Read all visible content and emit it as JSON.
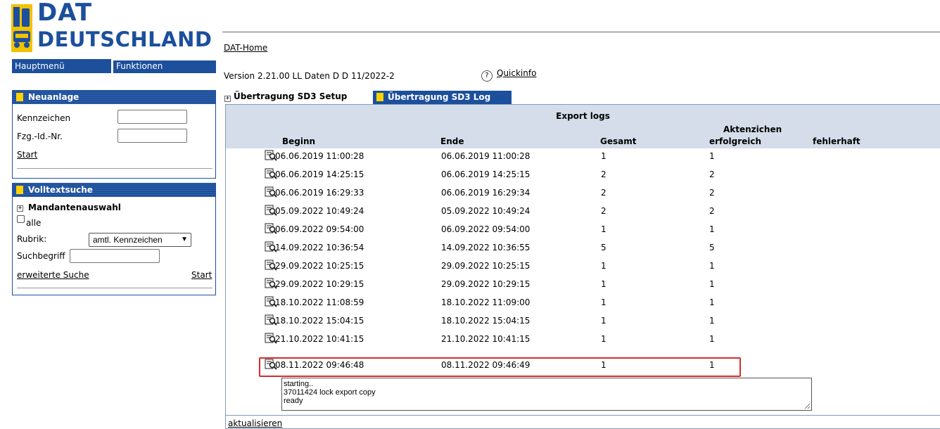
{
  "logo": {
    "line1": "DAT",
    "line2": "DEUTSCHLAND"
  },
  "menu": {
    "main": "Hauptmenü",
    "functions": "Funktionen"
  },
  "neuanlage": {
    "title": "Neuanlage",
    "kennzeichen_label": "Kennzeichen",
    "kennzeichen_value": "",
    "fzg_label": "Fzg.-Id.-Nr.",
    "fzg_value": "",
    "start": "Start"
  },
  "volltext": {
    "title": "Volltextsuche",
    "mandanten": "Mandantenauswahl",
    "alle": "alle",
    "rubrik_label": "Rubrik:",
    "rubrik_value": "amtl. Kennzeichen",
    "suchbegriff_label": "Suchbegriff",
    "suchbegriff_value": "",
    "erweitert": "erweiterte Suche",
    "start": "Start"
  },
  "header": {
    "home": "DAT-Home",
    "version": "Version 2.21.00  LL  Daten D D 11/2022-2",
    "quickinfo": "Quickinfo"
  },
  "tabs": {
    "setup": "Übertragung SD3 Setup",
    "log": "Übertragung SD3 Log"
  },
  "log": {
    "title": "Export logs",
    "columns": {
      "beginn": "Beginn",
      "ende": "Ende",
      "gesamt": "Gesamt",
      "aktenzichen": "Aktenzichen",
      "erfolgreich": "erfolgreich",
      "fehlerhaft": "fehlerhaft"
    },
    "rows": [
      {
        "beginn": "06.06.2019 11:00:28",
        "ende": "06.06.2019 11:00:28",
        "gesamt": "1",
        "erfolgreich": "1",
        "fehlerhaft": ""
      },
      {
        "beginn": "06.06.2019 14:25:15",
        "ende": "06.06.2019 14:25:15",
        "gesamt": "2",
        "erfolgreich": "2",
        "fehlerhaft": ""
      },
      {
        "beginn": "06.06.2019 16:29:33",
        "ende": "06.06.2019 16:29:34",
        "gesamt": "2",
        "erfolgreich": "2",
        "fehlerhaft": ""
      },
      {
        "beginn": "05.09.2022 10:49:24",
        "ende": "05.09.2022 10:49:24",
        "gesamt": "2",
        "erfolgreich": "2",
        "fehlerhaft": ""
      },
      {
        "beginn": "06.09.2022 09:54:00",
        "ende": "06.09.2022 09:54:00",
        "gesamt": "1",
        "erfolgreich": "1",
        "fehlerhaft": ""
      },
      {
        "beginn": "14.09.2022 10:36:54",
        "ende": "14.09.2022 10:36:55",
        "gesamt": "5",
        "erfolgreich": "5",
        "fehlerhaft": ""
      },
      {
        "beginn": "29.09.2022 10:25:15",
        "ende": "29.09.2022 10:25:15",
        "gesamt": "1",
        "erfolgreich": "1",
        "fehlerhaft": ""
      },
      {
        "beginn": "29.09.2022 10:29:15",
        "ende": "29.09.2022 10:29:15",
        "gesamt": "1",
        "erfolgreich": "1",
        "fehlerhaft": ""
      },
      {
        "beginn": "18.10.2022 11:08:59",
        "ende": "18.10.2022 11:09:00",
        "gesamt": "1",
        "erfolgreich": "1",
        "fehlerhaft": ""
      },
      {
        "beginn": "18.10.2022 15:04:15",
        "ende": "18.10.2022 15:04:15",
        "gesamt": "1",
        "erfolgreich": "1",
        "fehlerhaft": ""
      },
      {
        "beginn": "21.10.2022 10:41:15",
        "ende": "21.10.2022 10:41:15",
        "gesamt": "1",
        "erfolgreich": "1",
        "fehlerhaft": ""
      },
      {
        "beginn": "08.11.2022 09:46:48",
        "ende": "08.11.2022 09:46:49",
        "gesamt": "1",
        "erfolgreich": "1",
        "fehlerhaft": ""
      }
    ],
    "details": [
      "starting..",
      "37011424 lock  export  copy",
      "ready"
    ],
    "refresh": "aktualisieren"
  },
  "colors": {
    "brand_blue": "#1c4f9c",
    "accent_yellow": "#ffd200",
    "header_bg": "#d4dde9",
    "highlight_red": "#d62c2c"
  }
}
